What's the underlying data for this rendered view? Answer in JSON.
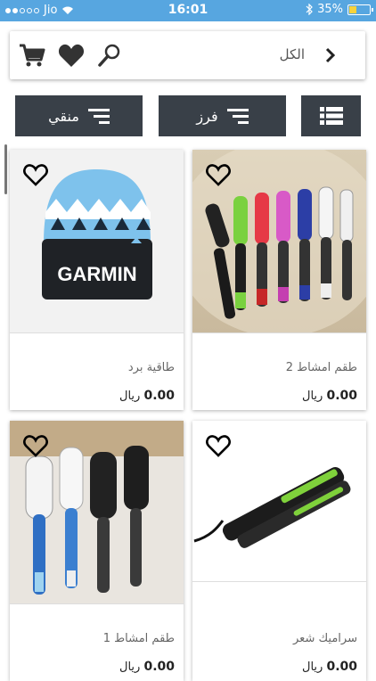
{
  "status": {
    "carrier": "Jio",
    "time": "16:01",
    "battery": "35%",
    "battery_level": 0.35
  },
  "search": {
    "label": "الكل"
  },
  "toolbar": {
    "filter_label": "منقي",
    "sort_label": "فرز"
  },
  "products": [
    {
      "name": "طقم امشاط 2",
      "price": "0.00",
      "currency": "ريال"
    },
    {
      "name": "طاقية برد",
      "price": "0.00",
      "currency": "ريال",
      "brand_text": "GARMIN"
    },
    {
      "name": "سراميك شعر",
      "price": "0.00",
      "currency": "ريال"
    },
    {
      "name": "طقم امشاط 1",
      "price": "0.00",
      "currency": "ريال"
    }
  ],
  "colors": {
    "status_bar": "#57a6e0",
    "toolbar_button": "#394048"
  }
}
